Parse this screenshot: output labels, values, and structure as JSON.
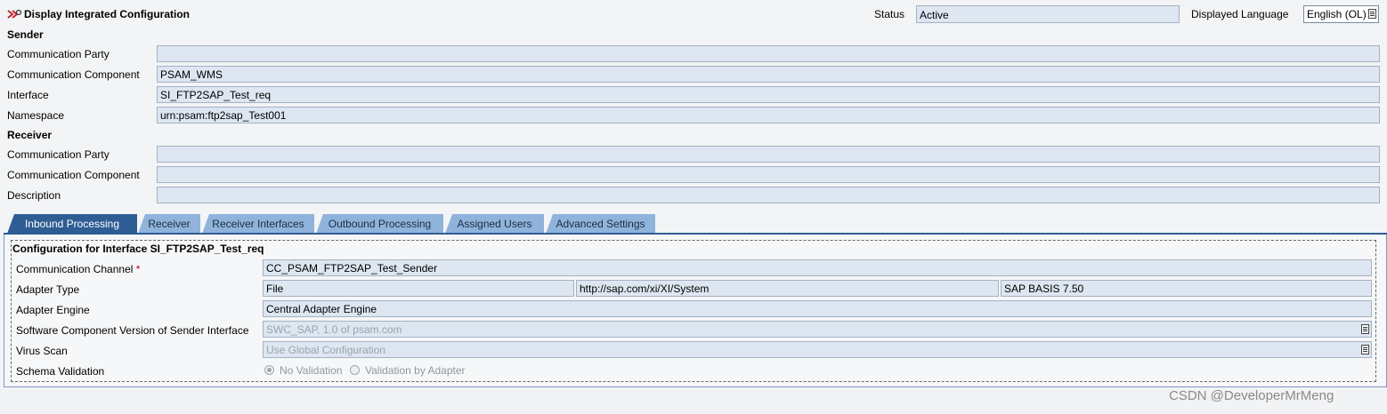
{
  "header": {
    "title": "Display Integrated Configuration",
    "status_label": "Status",
    "status_value": "Active",
    "language_label": "Displayed Language",
    "language_value": "English (OL)"
  },
  "sender": {
    "section_title": "Sender",
    "party_label": "Communication Party",
    "party_value": "",
    "component_label": "Communication Component",
    "component_value": "PSAM_WMS",
    "interface_label": "Interface",
    "interface_value": "SI_FTP2SAP_Test_req",
    "namespace_label": "Namespace",
    "namespace_value": "urn:psam:ftp2sap_Test001"
  },
  "receiver": {
    "section_title": "Receiver",
    "party_label": "Communication Party",
    "party_value": "",
    "component_label": "Communication Component",
    "component_value": "",
    "description_label": "Description",
    "description_value": ""
  },
  "tabs": [
    {
      "label": "Inbound Processing"
    },
    {
      "label": "Receiver"
    },
    {
      "label": "Receiver Interfaces"
    },
    {
      "label": "Outbound Processing"
    },
    {
      "label": "Assigned Users"
    },
    {
      "label": "Advanced Settings"
    }
  ],
  "config": {
    "title": "Configuration for Interface SI_FTP2SAP_Test_req",
    "channel_label": "Communication Channel",
    "channel_required": "*",
    "channel_value": "CC_PSAM_FTP2SAP_Test_Sender",
    "adapter_type_label": "Adapter Type",
    "adapter_type_value": "File",
    "adapter_namespace_value": "http://sap.com/xi/XI/System",
    "adapter_swc_value": "SAP BASIS 7.50",
    "engine_label": "Adapter Engine",
    "engine_value": "Central Adapter Engine",
    "swcv_label": "Software Component Version of Sender Interface",
    "swcv_value": "SWC_SAP, 1.0 of psam.com",
    "virus_label": "Virus Scan",
    "virus_value": "Use Global Configuration",
    "schema_label": "Schema Validation",
    "schema_option_1": "No Validation",
    "schema_option_2": "Validation by Adapter",
    "schema_selected": "No Validation"
  },
  "watermark": "CSDN @DeveloperMrMeng",
  "colors": {
    "field_bg": "#dde6f1",
    "tab_active": "#2e5d94",
    "tab_inactive": "#8fb3db"
  },
  "icons": {
    "header_icon": "integrated-config-icon",
    "dropdown_icon": "value-help-icon"
  }
}
